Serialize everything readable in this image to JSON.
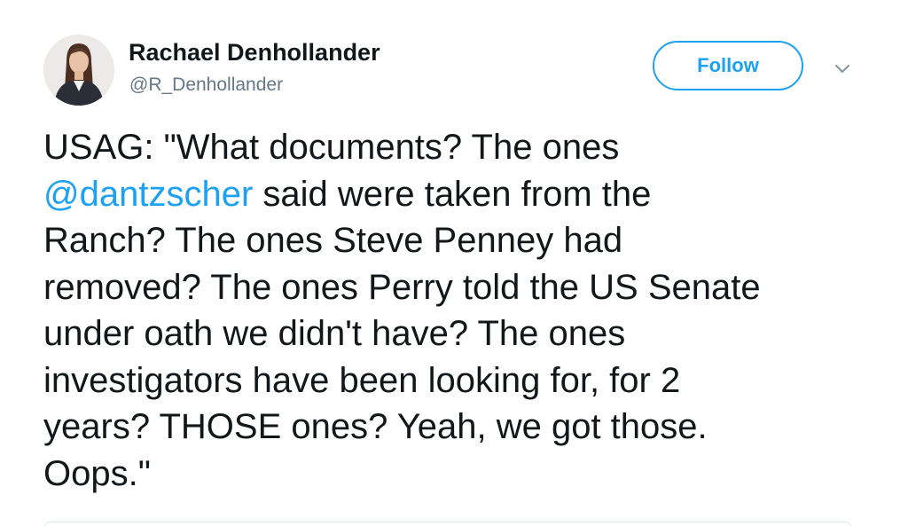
{
  "author": {
    "name": "Rachael Denhollander",
    "handle": "@R_Denhollander",
    "avatar_icon": "profile-photo"
  },
  "header": {
    "follow_label": "Follow",
    "menu_icon": "chevron-down-icon"
  },
  "tweet": {
    "lines": [
      {
        "parts": [
          {
            "text": "USAG: \"What documents? The ones"
          }
        ]
      },
      {
        "parts": [
          {
            "text": "@dantzscher",
            "mention": true
          },
          {
            "text": " said were taken from the"
          }
        ]
      },
      {
        "parts": [
          {
            "text": "Ranch? The ones Steve Penney had"
          }
        ]
      },
      {
        "parts": [
          {
            "text": "removed? The ones Perry told the US Senate"
          }
        ]
      },
      {
        "parts": [
          {
            "text": "under oath we didn't have? The ones"
          }
        ]
      },
      {
        "parts": [
          {
            "text": "investigators have been looking for, for 2"
          }
        ]
      },
      {
        "parts": [
          {
            "text": "years? THOSE ones? Yeah, we got those."
          }
        ]
      },
      {
        "parts": [
          {
            "text": "Oops.\""
          }
        ]
      }
    ]
  },
  "colors": {
    "accent": "#1da1f2",
    "text": "#14171a",
    "secondary_text": "#657786"
  }
}
